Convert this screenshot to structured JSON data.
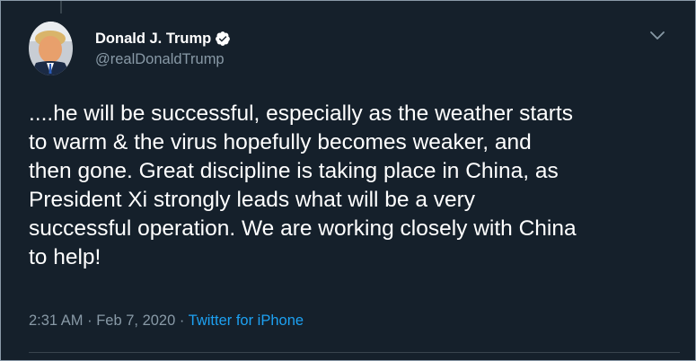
{
  "author": {
    "display_name": "Donald J. Trump",
    "handle": "@realDonaldTrump",
    "verified": true,
    "avatar_icon": "profile-photo"
  },
  "tweet": {
    "text": "....he will be successful, especially as the weather starts\nto warm & the virus hopefully becomes weaker, and\nthen gone. Great discipline is taking place in China, as\nPresident Xi strongly leads what will be a very\nsuccessful operation. We are working closely with China\nto help!",
    "time": "2:31 AM",
    "separator": " · ",
    "date": "Feb 7, 2020",
    "source": "Twitter for iPhone"
  },
  "icons": {
    "verified": "verified-badge-icon",
    "menu": "chevron-down-icon"
  },
  "colors": {
    "background": "#15202b",
    "text_primary": "#ffffff",
    "text_secondary": "#8899a6",
    "link": "#1da1f2"
  }
}
